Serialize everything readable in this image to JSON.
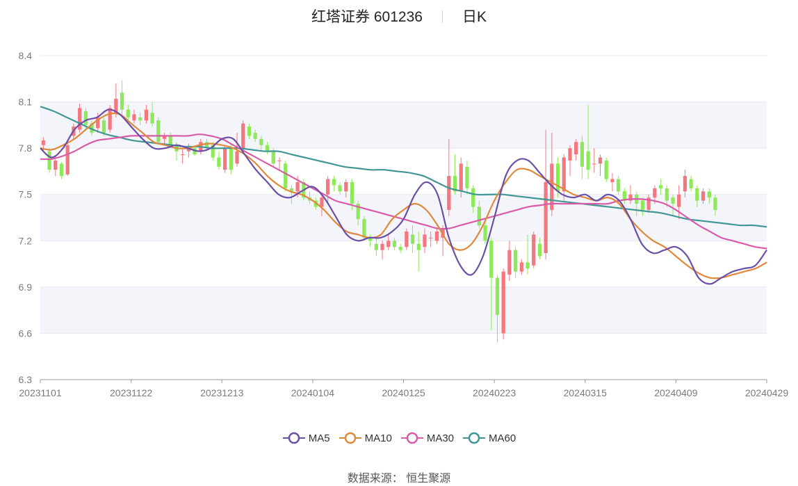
{
  "header": {
    "stock": "红塔证券 601236",
    "period": "日K"
  },
  "footer": {
    "source": "数据来源： 恒生聚源"
  },
  "colors": {
    "up": "#f4767f",
    "down": "#8de85a",
    "ma5": "#6b4ea6",
    "ma10": "#e0883b",
    "ma30": "#d95ba8",
    "ma60": "#3f9795",
    "grid": "#e4e8f2",
    "band": "#f4f5fa",
    "axis": "#7a7a7a"
  },
  "chart_data": {
    "type": "candlestick",
    "yticks": [
      "8.4",
      "8.1",
      "7.8",
      "7.5",
      "7.2",
      "6.9",
      "6.6",
      "6.3"
    ],
    "ylim": [
      6.3,
      8.4
    ],
    "xticks": [
      "20231101",
      "20231122",
      "20231213",
      "20240104",
      "20240125",
      "20240223",
      "20240315",
      "20240409",
      "20240429"
    ],
    "n_days": 120,
    "legend": [
      "MA5",
      "MA10",
      "MA30",
      "MA60"
    ],
    "candles": [
      [
        7.82,
        7.85,
        7.78,
        7.87
      ],
      [
        7.78,
        7.66,
        7.64,
        7.8
      ],
      [
        7.66,
        7.72,
        7.62,
        7.75
      ],
      [
        7.7,
        7.62,
        7.6,
        7.71
      ],
      [
        7.63,
        7.82,
        7.62,
        7.85
      ],
      [
        7.88,
        7.94,
        7.86,
        7.96
      ],
      [
        7.92,
        8.06,
        7.9,
        8.09
      ],
      [
        8.04,
        7.95,
        7.92,
        8.06
      ],
      [
        7.96,
        7.9,
        7.88,
        7.98
      ],
      [
        7.93,
        8.0,
        7.9,
        8.03
      ],
      [
        7.98,
        7.9,
        7.88,
        8.0
      ],
      [
        7.92,
        8.06,
        7.9,
        8.08
      ],
      [
        8.03,
        8.12,
        8.0,
        8.22
      ],
      [
        8.16,
        8.05,
        8.02,
        8.24
      ],
      [
        8.05,
        8.0,
        7.98,
        8.08
      ],
      [
        7.98,
        8.02,
        7.96,
        8.05
      ],
      [
        8.0,
        7.98,
        7.95,
        8.03
      ],
      [
        7.98,
        8.05,
        7.96,
        8.08
      ],
      [
        8.03,
        7.96,
        7.94,
        8.1
      ],
      [
        7.98,
        7.84,
        7.82,
        8.0
      ],
      [
        7.86,
        7.88,
        7.82,
        7.9
      ],
      [
        7.88,
        7.82,
        7.8,
        7.9
      ],
      [
        7.82,
        7.78,
        7.72,
        7.84
      ],
      [
        7.76,
        7.76,
        7.7,
        7.8
      ],
      [
        7.78,
        7.8,
        7.74,
        7.83
      ],
      [
        7.8,
        7.76,
        7.75,
        7.82
      ],
      [
        7.78,
        7.84,
        7.76,
        7.86
      ],
      [
        7.84,
        7.8,
        7.78,
        7.86
      ],
      [
        7.82,
        7.74,
        7.72,
        7.84
      ],
      [
        7.74,
        7.68,
        7.66,
        7.78
      ],
      [
        7.66,
        7.8,
        7.64,
        7.82
      ],
      [
        7.8,
        7.66,
        7.63,
        7.82
      ],
      [
        7.7,
        7.78,
        7.68,
        7.9
      ],
      [
        7.8,
        7.96,
        7.78,
        7.98
      ],
      [
        7.94,
        7.88,
        7.86,
        7.96
      ],
      [
        7.9,
        7.86,
        7.84,
        7.92
      ],
      [
        7.86,
        7.82,
        7.78,
        7.88
      ],
      [
        7.82,
        7.78,
        7.76,
        7.84
      ],
      [
        7.78,
        7.7,
        7.68,
        7.8
      ],
      [
        7.72,
        7.72,
        7.66,
        7.74
      ],
      [
        7.7,
        7.54,
        7.52,
        7.72
      ],
      [
        7.54,
        7.52,
        7.44,
        7.56
      ],
      [
        7.52,
        7.58,
        7.48,
        7.62
      ],
      [
        7.58,
        7.48,
        7.46,
        7.6
      ],
      [
        7.48,
        7.46,
        7.44,
        7.52
      ],
      [
        7.46,
        7.42,
        7.4,
        7.48
      ],
      [
        7.42,
        7.48,
        7.36,
        7.5
      ],
      [
        7.5,
        7.6,
        7.44,
        7.62
      ],
      [
        7.6,
        7.56,
        7.52,
        7.62
      ],
      [
        7.56,
        7.52,
        7.5,
        7.58
      ],
      [
        7.52,
        7.58,
        7.48,
        7.6
      ],
      [
        7.58,
        7.44,
        7.4,
        7.6
      ],
      [
        7.44,
        7.34,
        7.3,
        7.46
      ],
      [
        7.34,
        7.22,
        7.2,
        7.36
      ],
      [
        7.22,
        7.2,
        7.16,
        7.24
      ],
      [
        7.18,
        7.14,
        7.1,
        7.22
      ],
      [
        7.14,
        7.18,
        7.08,
        7.2
      ],
      [
        7.16,
        7.2,
        7.14,
        7.24
      ],
      [
        7.2,
        7.16,
        7.14,
        7.22
      ],
      [
        7.16,
        7.14,
        7.12,
        7.18
      ],
      [
        7.16,
        7.26,
        7.14,
        7.28
      ],
      [
        7.24,
        7.18,
        7.12,
        7.3
      ],
      [
        7.18,
        7.14,
        7.0,
        7.26
      ],
      [
        7.16,
        7.24,
        7.12,
        7.28
      ],
      [
        7.22,
        7.22,
        7.16,
        7.26
      ],
      [
        7.2,
        7.26,
        7.18,
        7.28
      ],
      [
        7.22,
        7.28,
        7.1,
        7.3
      ],
      [
        7.4,
        7.62,
        7.36,
        7.86
      ],
      [
        7.62,
        7.52,
        7.5,
        7.76
      ],
      [
        7.52,
        7.7,
        7.48,
        7.74
      ],
      [
        7.68,
        7.54,
        7.5,
        7.72
      ],
      [
        7.54,
        7.42,
        7.38,
        7.56
      ],
      [
        7.42,
        7.3,
        7.28,
        7.46
      ],
      [
        7.3,
        7.2,
        7.18,
        7.32
      ],
      [
        7.2,
        6.96,
        6.62,
        7.22
      ],
      [
        6.96,
        6.72,
        6.54,
        6.98
      ],
      [
        6.6,
        7.0,
        6.56,
        7.02
      ],
      [
        6.98,
        7.14,
        6.94,
        7.2
      ],
      [
        7.14,
        7.0,
        6.96,
        7.16
      ],
      [
        7.0,
        7.06,
        6.98,
        7.08
      ],
      [
        7.06,
        7.02,
        6.98,
        7.24
      ],
      [
        7.04,
        7.24,
        7.02,
        7.26
      ],
      [
        7.18,
        7.1,
        7.08,
        7.22
      ],
      [
        7.12,
        7.58,
        7.08,
        7.92
      ],
      [
        7.4,
        7.7,
        7.36,
        7.9
      ],
      [
        7.7,
        7.52,
        7.48,
        7.74
      ],
      [
        7.52,
        7.74,
        7.46,
        7.76
      ],
      [
        7.72,
        7.8,
        7.62,
        7.82
      ],
      [
        7.76,
        7.84,
        7.72,
        7.86
      ],
      [
        7.84,
        7.68,
        7.6,
        7.88
      ],
      [
        7.78,
        7.66,
        7.6,
        8.08
      ],
      [
        7.7,
        7.7,
        7.64,
        7.8
      ],
      [
        7.7,
        7.74,
        7.62,
        7.76
      ],
      [
        7.72,
        7.6,
        7.58,
        7.74
      ],
      [
        7.58,
        7.6,
        7.52,
        7.64
      ],
      [
        7.6,
        7.52,
        7.5,
        7.62
      ],
      [
        7.52,
        7.46,
        7.44,
        7.54
      ],
      [
        7.46,
        7.5,
        7.44,
        7.56
      ],
      [
        7.5,
        7.44,
        7.36,
        7.52
      ],
      [
        7.46,
        7.4,
        7.36,
        7.48
      ],
      [
        7.4,
        7.48,
        7.38,
        7.5
      ],
      [
        7.48,
        7.54,
        7.44,
        7.56
      ],
      [
        7.56,
        7.54,
        7.5,
        7.6
      ],
      [
        7.54,
        7.46,
        7.42,
        7.56
      ],
      [
        7.48,
        7.44,
        7.36,
        7.5
      ],
      [
        7.42,
        7.5,
        7.34,
        7.56
      ],
      [
        7.52,
        7.62,
        7.48,
        7.66
      ],
      [
        7.6,
        7.54,
        7.52,
        7.62
      ],
      [
        7.54,
        7.46,
        7.42,
        7.56
      ],
      [
        7.46,
        7.52,
        7.44,
        7.54
      ],
      [
        7.52,
        7.48,
        7.44,
        7.54
      ],
      [
        7.48,
        7.4,
        7.36,
        7.5
      ]
    ],
    "ma5": [
      7.8,
      7.74,
      7.8,
      7.92,
      7.98,
      8.0,
      8.05,
      8.02,
      7.94,
      7.86,
      7.8,
      7.8,
      7.82,
      7.8,
      7.78,
      7.8,
      7.86,
      7.86,
      7.76,
      7.66,
      7.58,
      7.5,
      7.48,
      7.52,
      7.55,
      7.48,
      7.36,
      7.24,
      7.2,
      7.22,
      7.22,
      7.26,
      7.34,
      7.5,
      7.58,
      7.5,
      7.22,
      7.04,
      6.98,
      7.1,
      7.35,
      7.62,
      7.72,
      7.72,
      7.64,
      7.56,
      7.5,
      7.48,
      7.5,
      7.46,
      7.5,
      7.46,
      7.34,
      7.18,
      7.12,
      7.14,
      7.16,
      7.1,
      6.96,
      6.92,
      6.96,
      7.0,
      7.02,
      7.04,
      7.14
    ],
    "ma10": [
      7.8,
      7.79,
      7.82,
      7.86,
      7.92,
      7.98,
      8.02,
      8.02,
      7.96,
      7.9,
      7.84,
      7.82,
      7.8,
      7.8,
      7.82,
      7.83,
      7.82,
      7.8,
      7.76,
      7.7,
      7.62,
      7.56,
      7.52,
      7.5,
      7.46,
      7.4,
      7.32,
      7.26,
      7.24,
      7.22,
      7.24,
      7.34,
      7.4,
      7.44,
      7.4,
      7.3,
      7.18,
      7.14,
      7.18,
      7.3,
      7.46,
      7.58,
      7.66,
      7.66,
      7.62,
      7.58,
      7.54,
      7.5,
      7.48,
      7.46,
      7.48,
      7.44,
      7.34,
      7.26,
      7.2,
      7.16,
      7.1,
      7.04,
      6.99,
      6.96,
      6.96,
      6.98,
      7.0,
      7.02,
      7.06
    ],
    "ma30": [
      7.73,
      7.73,
      7.75,
      7.78,
      7.82,
      7.85,
      7.86,
      7.87,
      7.88,
      7.88,
      7.88,
      7.88,
      7.88,
      7.88,
      7.89,
      7.88,
      7.86,
      7.82,
      7.78,
      7.74,
      7.7,
      7.66,
      7.62,
      7.58,
      7.54,
      7.5,
      7.46,
      7.44,
      7.42,
      7.4,
      7.38,
      7.36,
      7.34,
      7.32,
      7.3,
      7.28,
      7.28,
      7.3,
      7.32,
      7.34,
      7.36,
      7.38,
      7.4,
      7.42,
      7.43,
      7.44,
      7.44,
      7.44,
      7.44,
      7.44,
      7.44,
      7.46,
      7.47,
      7.47,
      7.46,
      7.44,
      7.4,
      7.35,
      7.3,
      7.26,
      7.22,
      7.2,
      7.18,
      7.16,
      7.15
    ],
    "ma60": [
      8.07,
      8.04,
      8.0,
      7.96,
      7.92,
      7.89,
      7.87,
      7.85,
      7.84,
      7.83,
      7.82,
      7.81,
      7.81,
      7.8,
      7.8,
      7.8,
      7.79,
      7.78,
      7.78,
      7.76,
      7.74,
      7.72,
      7.7,
      7.68,
      7.67,
      7.66,
      7.66,
      7.65,
      7.64,
      7.62,
      7.58,
      7.54,
      7.52,
      7.5,
      7.5,
      7.5,
      7.49,
      7.48,
      7.47,
      7.46,
      7.45,
      7.44,
      7.43,
      7.42,
      7.41,
      7.4,
      7.39,
      7.38,
      7.36,
      7.34,
      7.33,
      7.32,
      7.31,
      7.3,
      7.3,
      7.29
    ]
  }
}
